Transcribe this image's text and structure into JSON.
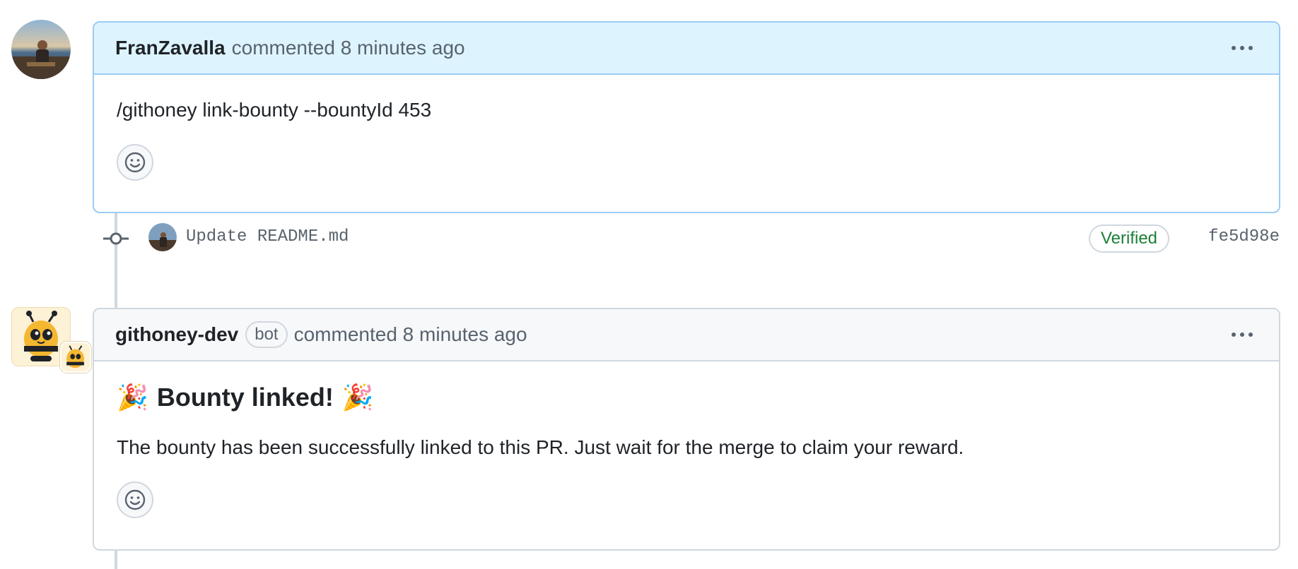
{
  "comments": [
    {
      "author": "FranZavalla",
      "meta": "commented 8 minutes ago",
      "body": "/githoney link-bounty --bountyId 453"
    },
    {
      "author": "githoney-dev",
      "badge": "bot",
      "meta": "commented 8 minutes ago",
      "heading": "Bounty linked!",
      "heading_emoji": "🎉",
      "body": "The bounty has been successfully linked to this PR. Just wait for the merge to claim your reward."
    }
  ],
  "commit": {
    "message": "Update README.md",
    "verified_label": "Verified",
    "sha": "fe5d98e"
  },
  "icons": {
    "kebab": "kebab-horizontal-icon",
    "reaction": "smiley-icon",
    "commit": "git-commit-icon",
    "party": "party-popper-icon"
  },
  "colors": {
    "highlight_header": "#ddf4ff",
    "highlight_border": "#9ccbf5",
    "verified_green": "#1a7f37",
    "timeline": "#d0d7de"
  }
}
